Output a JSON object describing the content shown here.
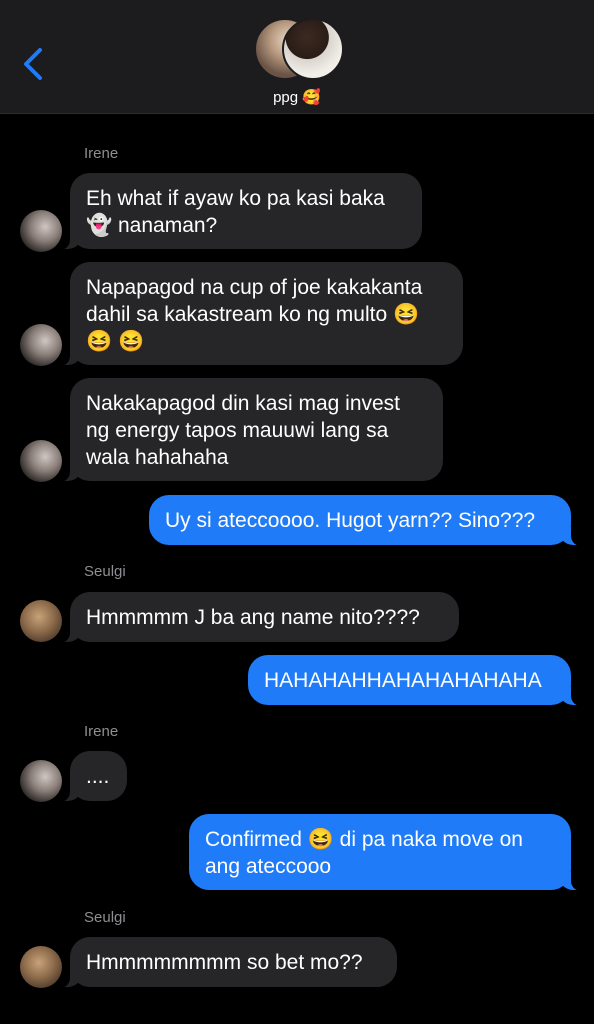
{
  "header": {
    "group_name": "ppg 🥰",
    "back_icon": "chevron-left-icon",
    "accent_color": "#1f7bf7"
  },
  "messages": [
    {
      "sender": "Irene",
      "text": "Eh what if ayaw ko pa kasi baka\n👻 nanaman?"
    },
    {
      "text": "Napapagod na cup of joe kakakanta\ndahil sa kakastream ko ng multo 😆\n😆 😆"
    },
    {
      "text": "Nakakapagod din kasi mag invest\nng energy tapos mauuwi lang sa\nwala hahahaha"
    },
    {
      "text": "Uy si ateccoooo. Hugot yarn?? Sino???"
    },
    {
      "sender": "Seulgi",
      "text": "Hmmmmm J ba ang name nito????"
    },
    {
      "text": "HAHAHAHHAHAHAHAHAHA"
    },
    {
      "sender": "Irene",
      "text": "...."
    },
    {
      "text": "Confirmed 😆 di pa naka move on\nang ateccooo"
    },
    {
      "sender": "Seulgi",
      "text": "Hmmmmmmmm so bet mo??"
    }
  ]
}
